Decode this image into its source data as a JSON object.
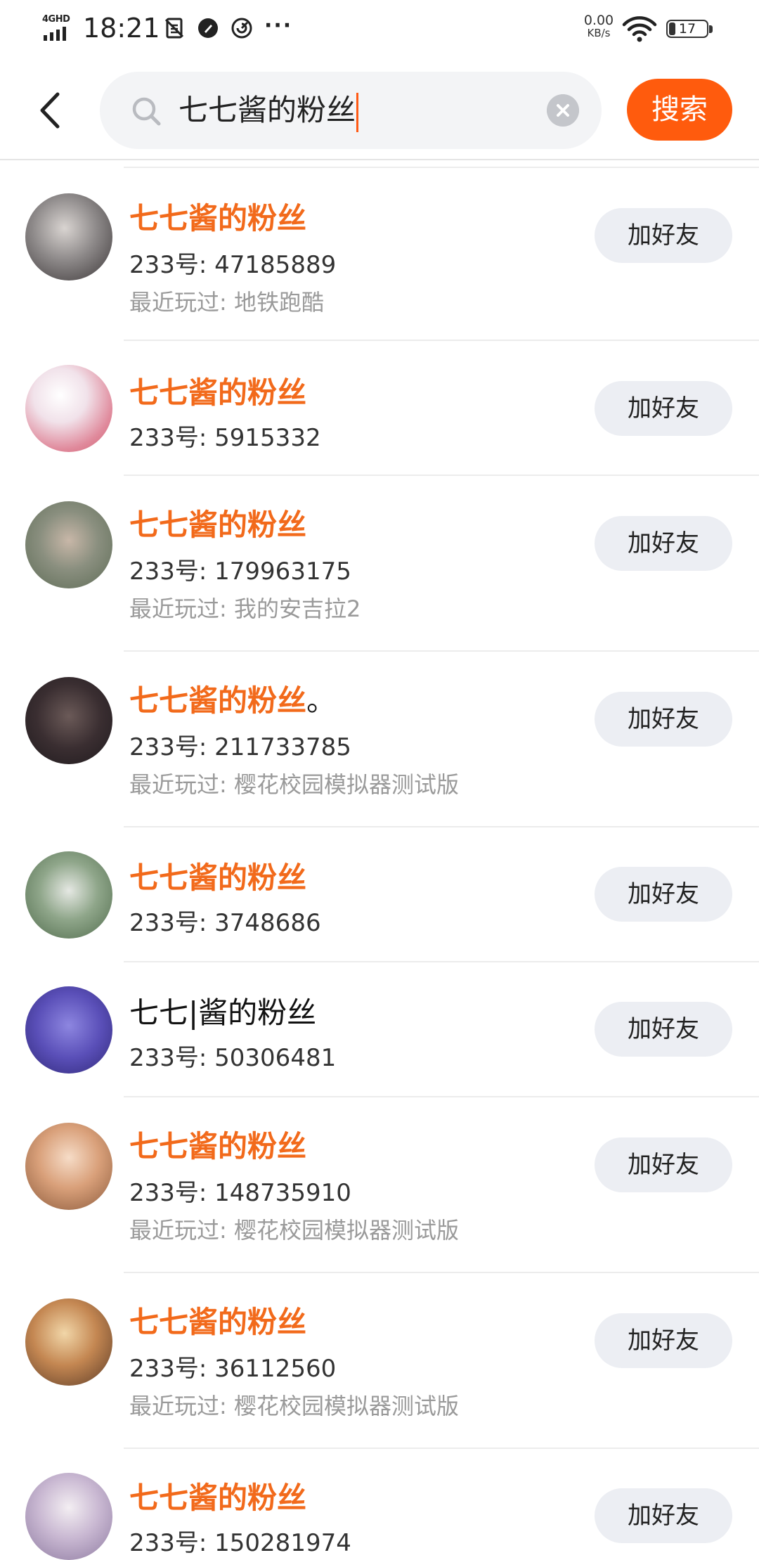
{
  "status_bar": {
    "network": "4GHD",
    "time": "18:21",
    "speed_value": "0.00",
    "speed_unit": "KB/s",
    "battery": "17",
    "battery_level": 0.17,
    "icons": [
      "sim-icon",
      "app-icon",
      "app-icon-2",
      "more-dots-icon",
      "wifi-icon",
      "battery-icon"
    ]
  },
  "search": {
    "query": "七七酱的粉丝",
    "button_label": "搜索",
    "accent_color": "#ff5b0d"
  },
  "colors": {
    "highlight": "#f26a1b",
    "button_bg": "#eceef3"
  },
  "results": [
    {
      "nickname": "七七酱的粉丝",
      "suffix": "",
      "highlight": true,
      "uid": "233号: 47185889",
      "played": "最近玩过: 地铁跑酷",
      "add_label": "加好友"
    },
    {
      "nickname": "七七酱的粉丝",
      "suffix": "",
      "highlight": true,
      "uid": "233号: 5915332",
      "played": "",
      "add_label": "加好友"
    },
    {
      "nickname": "七七酱的粉丝",
      "suffix": "",
      "highlight": true,
      "uid": "233号: 179963175",
      "played": "最近玩过: 我的安吉拉2",
      "add_label": "加好友"
    },
    {
      "nickname": "七七酱的粉丝",
      "suffix": "。",
      "highlight": true,
      "uid": "233号: 211733785",
      "played": "最近玩过: 樱花校园模拟器测试版",
      "add_label": "加好友"
    },
    {
      "nickname": "七七酱的粉丝",
      "suffix": "",
      "highlight": true,
      "uid": "233号: 3748686",
      "played": "",
      "add_label": "加好友"
    },
    {
      "nickname": "七七|酱的粉丝",
      "suffix": "",
      "highlight": false,
      "uid": "233号: 50306481",
      "played": "",
      "add_label": "加好友"
    },
    {
      "nickname": "七七酱的粉丝",
      "suffix": "",
      "highlight": true,
      "uid": "233号: 148735910",
      "played": "最近玩过: 樱花校园模拟器测试版",
      "add_label": "加好友"
    },
    {
      "nickname": "七七酱的粉丝",
      "suffix": "",
      "highlight": true,
      "uid": "233号: 36112560",
      "played": "最近玩过: 樱花校园模拟器测试版",
      "add_label": "加好友"
    },
    {
      "nickname": "七七酱的粉丝",
      "suffix": "",
      "highlight": true,
      "uid": "233号: 150281974",
      "played": "",
      "add_label": "加好友"
    }
  ]
}
